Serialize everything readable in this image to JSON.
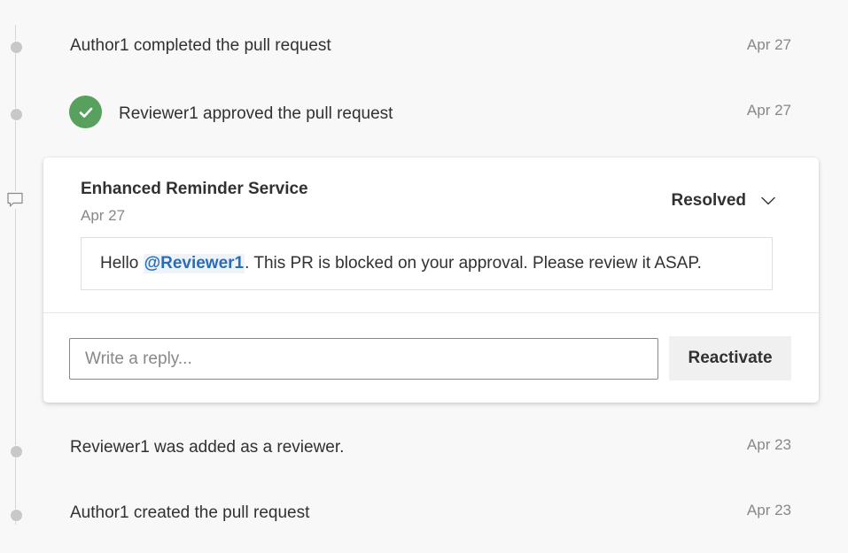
{
  "events": [
    {
      "text": "Author1 completed the pull request",
      "date": "Apr 27"
    },
    {
      "text": "Reviewer1 approved the pull request",
      "date": "Apr 27"
    },
    {
      "text": "Reviewer1 was added as a reviewer.",
      "date": "Apr 23"
    },
    {
      "text": "Author1 created the pull request",
      "date": "Apr 23"
    }
  ],
  "comment": {
    "title": "Enhanced Reminder Service",
    "date": "Apr 27",
    "status": "Resolved",
    "message_prefix": "Hello ",
    "mention": "@Reviewer1",
    "message_suffix": ". This PR is blocked on your approval. Please review it ASAP.",
    "reply_placeholder": "Write a reply...",
    "reactivate_label": "Reactivate"
  },
  "colors": {
    "approved": "#57a05d",
    "mention": "#2b6cb6"
  },
  "icons": {
    "approved": "checkmark-icon",
    "comment": "comment-icon",
    "status": "chevron-down-icon"
  }
}
